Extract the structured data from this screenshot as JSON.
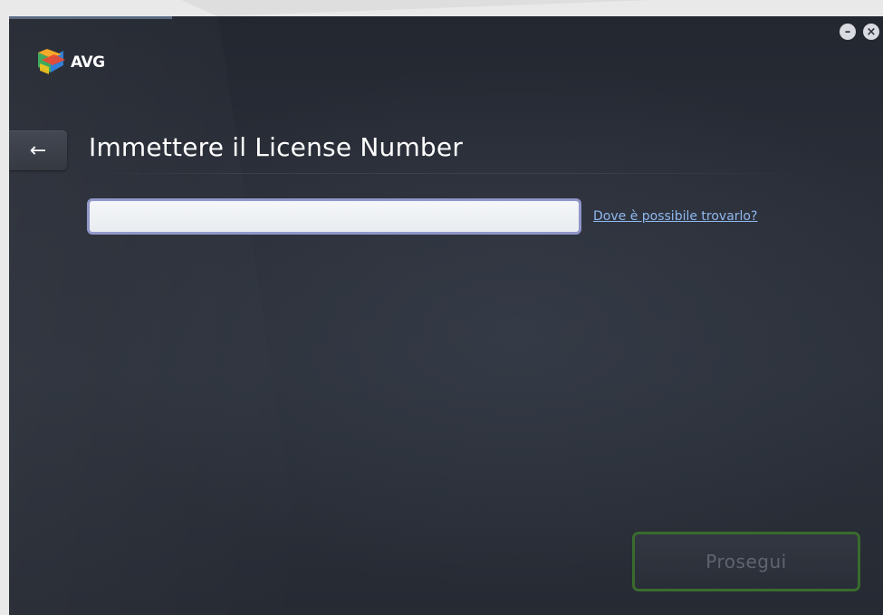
{
  "app": {
    "brand": "AVG",
    "brand_colors": [
      "#f5a623",
      "#e8452c",
      "#3aa757",
      "#2b7bd6"
    ]
  },
  "window_controls": {
    "minimize_glyph": "–",
    "close_glyph": "×"
  },
  "header": {
    "back_glyph": "←",
    "title": "Immettere il License Number"
  },
  "form": {
    "license_value": "",
    "help_link": "Dove è possibile trovarlo?"
  },
  "actions": {
    "continue_label": "Prosegui",
    "continue_enabled": false
  },
  "colors": {
    "accent_border": "#8f96c8",
    "link": "#8fb8ef",
    "continue_border": "#3a6b2e"
  }
}
